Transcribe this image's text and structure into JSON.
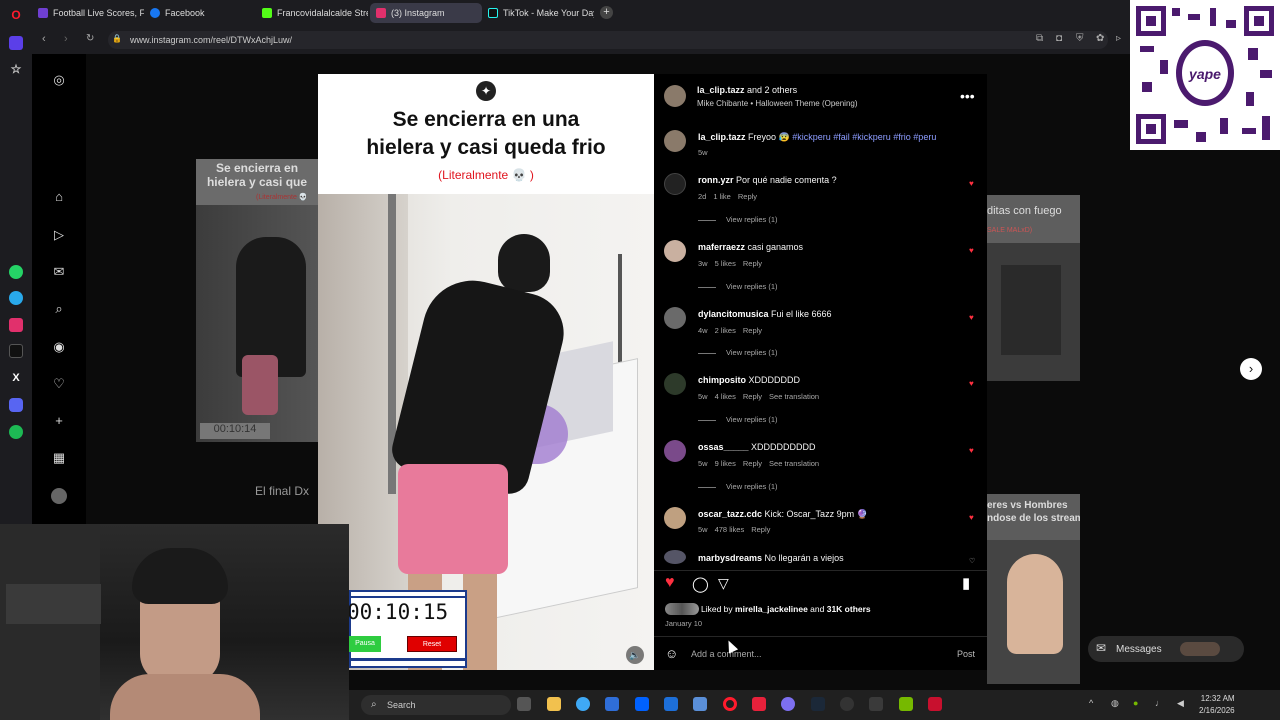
{
  "browser": {
    "tabs": [
      {
        "label": "Football Live Scores, Fixtu",
        "color": "#6f3fd1"
      },
      {
        "label": "Facebook",
        "color": "#1877f2"
      },
      {
        "label": "Francovidalalcalde Stream",
        "color": "#53fc18"
      },
      {
        "label": "(3) Instagram",
        "color": "#e1306c"
      },
      {
        "label": "TikTok - Make Your Day",
        "color": "#111111"
      }
    ],
    "url": "www.instagram.com/reel/DTWxAchjLuw/"
  },
  "video": {
    "caption_line1": "Se encierra en una",
    "caption_line2": "hielera y casi queda frio",
    "caption_sub": "(Literalmente 💀 )",
    "timer": "00:10:15",
    "timer_btn_left": "Pausa",
    "timer_btn_right": "Reset"
  },
  "side_reels": {
    "left_title": "Se encierra en\nhielera y casi que",
    "left_sub": "(Literalmente 💀",
    "left_timer": "00:10:14",
    "left_caption": "El final Dx",
    "right_title": "ditas con fuego",
    "right_sub": "SALE MALxD)",
    "right2_title": "eres vs Hombres",
    "right2_sub": "ndose de los streams"
  },
  "post": {
    "author": "la_clip.tazz",
    "author_suffix": " and 2 others",
    "song": "Mike Chibante • Halloween Theme (Opening)",
    "caption_user": "la_clip.tazz",
    "caption_text": " Freyoo 😰 ",
    "caption_tags": "#kickperu #fail #kickperu #frio #peru",
    "caption_age": "5w",
    "liked_by_prefix": "Liked by ",
    "liked_by_user": "mirella_jackelinee",
    "liked_by_suffix": " and ",
    "liked_by_count": "31K others",
    "date": "January 10",
    "comment_placeholder": "Add a comment...",
    "post_button": "Post"
  },
  "comments": [
    {
      "user": "ronn.yzr",
      "text": " Por qué nadie comenta ?",
      "age": "2d",
      "likes": "1 like",
      "reply": "Reply",
      "translation": "",
      "replies": "View replies (1)"
    },
    {
      "user": "maferraezz",
      "text": " casi ganamos",
      "age": "3w",
      "likes": "5 likes",
      "reply": "Reply",
      "translation": "",
      "replies": "View replies (1)"
    },
    {
      "user": "dylancitomusica",
      "text": " Fui el like 6666",
      "age": "4w",
      "likes": "2 likes",
      "reply": "Reply",
      "translation": "",
      "replies": "View replies (1)"
    },
    {
      "user": "chimposito",
      "text": " XDDDDDDD",
      "age": "5w",
      "likes": "4 likes",
      "reply": "Reply",
      "translation": "See translation",
      "replies": "View replies (1)"
    },
    {
      "user": "ossas_____",
      "text": " XDDDDDDDDD",
      "age": "5w",
      "likes": "9 likes",
      "reply": "Reply",
      "translation": "See translation",
      "replies": "View replies (1)"
    },
    {
      "user": "oscar_tazz.cdc",
      "text": " Kick: Oscar_Tazz 9pm 🔮",
      "age": "5w",
      "likes": "478 likes",
      "reply": "Reply",
      "translation": "",
      "replies": ""
    },
    {
      "user": "marbysdreams",
      "text": " No llegarán a viejos",
      "age": "",
      "likes": "",
      "reply": "",
      "translation": "",
      "replies": ""
    }
  ],
  "messages": {
    "label": "Messages"
  },
  "taskbar": {
    "search": "Search",
    "time": "12:32 AM",
    "date": "2/16/2026"
  },
  "qr": {
    "brand": "yape"
  },
  "colors": {
    "accent": "#ff3040",
    "tag": "#8c9cff",
    "qr": "#4b1a6e"
  }
}
